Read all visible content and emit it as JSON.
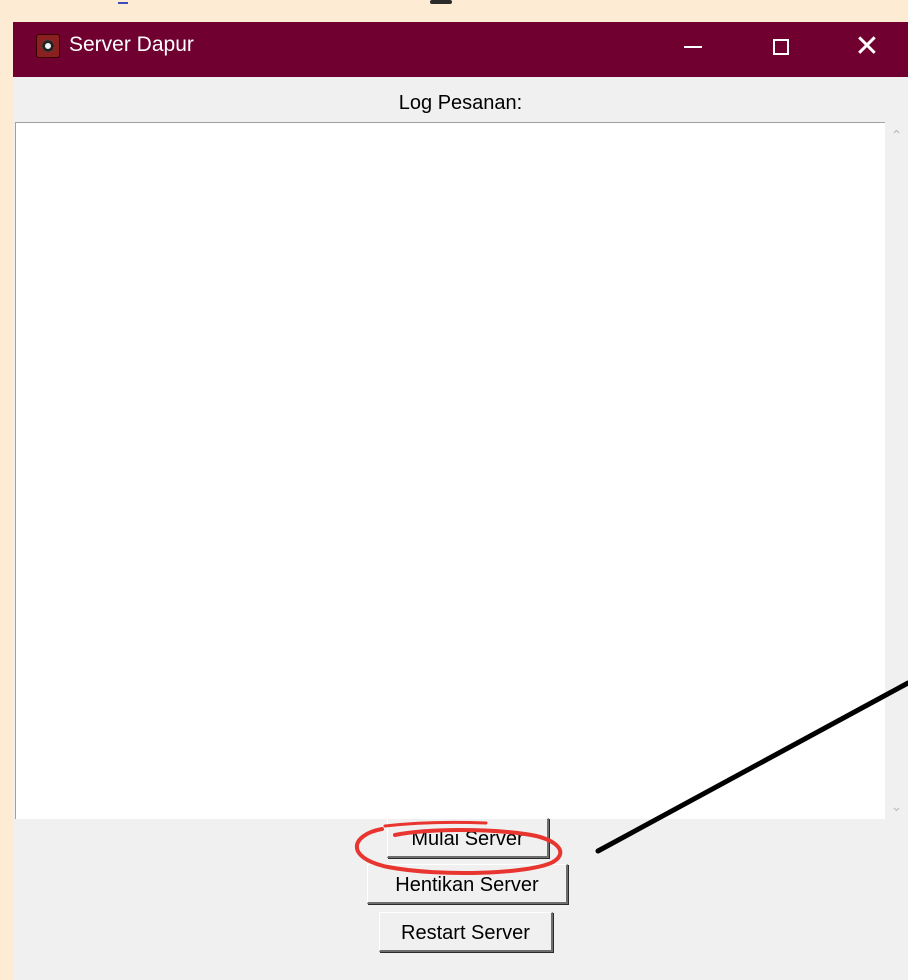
{
  "window": {
    "title": "Server Dapur",
    "title_bar_color": "#6f0030",
    "icons": {
      "app": "app-icon",
      "minimize": "minimize-icon",
      "maximize": "maximize-icon",
      "close": "close-icon"
    },
    "glyphs": {
      "close": "✕"
    }
  },
  "log": {
    "label": "Log Pesanan:",
    "content": ""
  },
  "buttons": {
    "start_label": "Mulai Server",
    "stop_label": "Hentikan Server",
    "restart_label": "Restart Server"
  },
  "annotation": {
    "highlight_color": "#e8352f",
    "arrow_color": "#000000"
  }
}
